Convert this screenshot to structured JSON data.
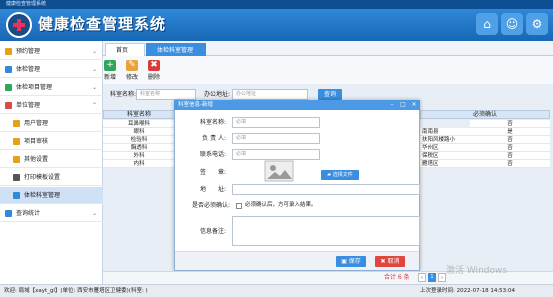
{
  "window_title": "健康检查管理系统",
  "app_title": "健康检查管理系统",
  "sidebar": {
    "items": [
      {
        "label": "预约管理"
      },
      {
        "label": "体检管理"
      },
      {
        "label": "体检项目管理"
      },
      {
        "label": "单位管理"
      },
      {
        "label": "用户管理"
      },
      {
        "label": "项目审核"
      },
      {
        "label": "其他设置"
      },
      {
        "label": "打印模板设置"
      },
      {
        "label": "体检科室管理"
      },
      {
        "label": "查询统计"
      }
    ]
  },
  "tabs": [
    {
      "label": "首页"
    },
    {
      "label": "体检科室管理 ×"
    }
  ],
  "toolbar": {
    "add": "新增",
    "edit": "修改",
    "delete": "删除"
  },
  "search": {
    "name_label": "科室名称:",
    "name_placeholder": "科室名称",
    "addr_label": "办公地址:",
    "addr_placeholder": "办公地址",
    "button": "查询"
  },
  "table": {
    "col_name": "科室名称",
    "col_required": "必须确认",
    "names": [
      "耳鼻喉科",
      "眼科",
      "检验科",
      "胸透科",
      "外科",
      "内科"
    ],
    "right_partial": [
      "南南县",
      "扶阳风楼路小",
      "华州区",
      "保税区",
      "雁塔区"
    ],
    "required": [
      "否",
      "是",
      "否",
      "否",
      "否",
      "否"
    ]
  },
  "dialog": {
    "title": "科室信息-新增",
    "name_label": "科室名称:",
    "name_placeholder": "必填",
    "head_label": "负 责 人:",
    "head_placeholder": "必填",
    "phone_label": "联系电话:",
    "phone_placeholder": "必填",
    "sign_label": "签　　章:",
    "choose_file": "选择文件",
    "addr_label": "地　　址:",
    "confirm_label": "是否必须确认:",
    "confirm_text": "必须确认后，方可录入结果。",
    "remark_label": "信息备注:",
    "save": "保存",
    "cancel": "取消"
  },
  "pager": {
    "total": "合计 6 条",
    "page": "1"
  },
  "watermark": "激活 Windows",
  "status": {
    "left": "欢迎: 局域【xayt_gl】(单位: 西安市雁塔区卫健委)(科室: )",
    "right": "上次登录时间: 2022-07-18 14:53:04"
  }
}
